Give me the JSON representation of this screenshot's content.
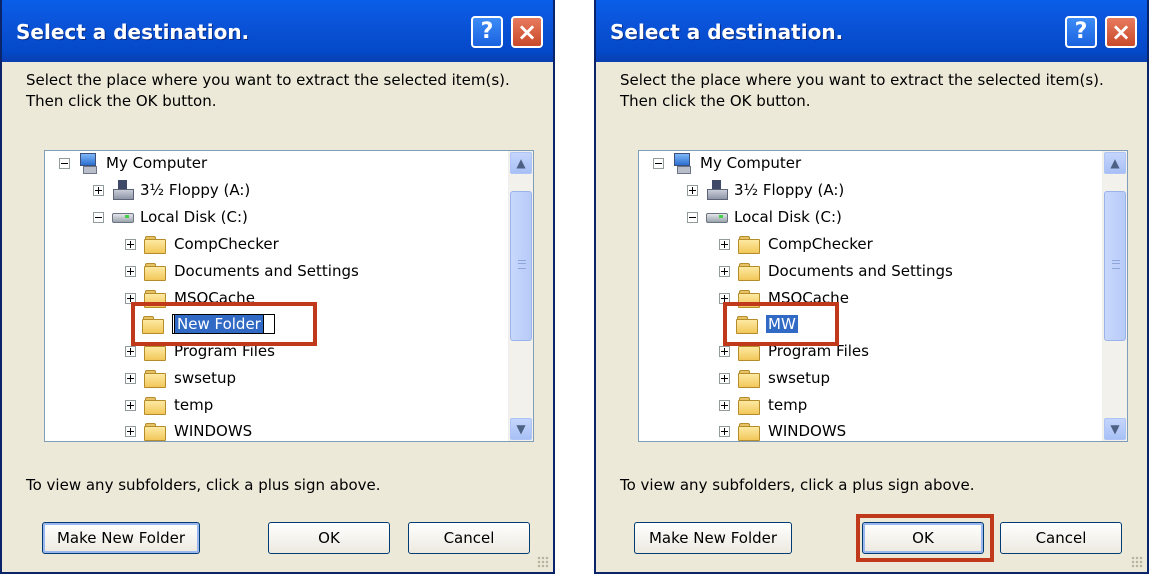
{
  "dialog": {
    "title": "Select a destination.",
    "help_glyph": "?",
    "close_glyph": "×",
    "description": "Select the place where you want to extract the selected item(s).  Then click the OK button.",
    "hint": "To view any subfolders, click a plus sign above.",
    "buttons": {
      "make_new_folder": "Make New Folder",
      "ok": "OK",
      "cancel": "Cancel"
    },
    "scroll": {
      "up_glyph": "▲",
      "down_glyph": "▼"
    }
  },
  "tree": {
    "my_computer": "My Computer",
    "floppy": "3½ Floppy (A:)",
    "local_disk": "Local Disk (C:)",
    "folders": [
      "CompChecker",
      "Documents and Settings",
      "MSOCache",
      "Program Files",
      "swsetup",
      "temp",
      "WINDOWS"
    ]
  },
  "left_panel": {
    "new_folder_edit": "New Folder"
  },
  "right_panel": {
    "new_folder_name": "MW"
  },
  "colors": {
    "highlight_box": "#c0391b",
    "selection": "#316ac5",
    "titlebar": "#0a53d8"
  }
}
